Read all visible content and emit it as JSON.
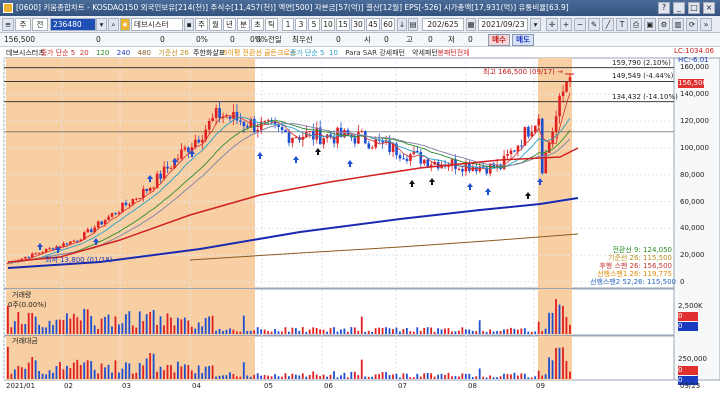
{
  "window": {
    "title": "[0600] 키움종합차트 - KOSDAQ150 외국인보유[214(천)] 주식수[11,457(천)] 액면[500] 자본금[57(억)] 결산[12월] EPS[-526] 시가총액[17,931(억)] 유통비율[63.9]",
    "buttons": [
      "?",
      "_",
      "□",
      "×"
    ]
  },
  "toolbar": {
    "tabs": [
      "주",
      "전"
    ],
    "code": "236480",
    "name": "데브시스터",
    "period_buttons": [
      "주",
      "월",
      "년",
      "분",
      "초",
      "틱"
    ],
    "intervals": [
      "1",
      "3",
      "5",
      "10",
      "15",
      "30",
      "45",
      "60"
    ],
    "count": "202/625",
    "date": "2021/09/23"
  },
  "infobar": {
    "price": "156,500",
    "v1": "0",
    "v2": "0",
    "v3": "0%",
    "v4": "0",
    "v5": "0%",
    "prev_label": "0%전일",
    "prev_val": "0",
    "ratio_label": "최우선",
    "k1": "0",
    "k2": "시",
    "k3": "0",
    "k4": "고",
    "k5": "0",
    "k6": "저",
    "k7": "0",
    "buy": "매수",
    "sell": "매도"
  },
  "indicators": [
    {
      "text": "데브시스터즈",
      "color": "#111111"
    },
    {
      "text": "종가 단순 5",
      "color": "#d03030"
    },
    {
      "text": "20",
      "color": "#d03030"
    },
    {
      "text": "120",
      "color": "#2a8a2a"
    },
    {
      "text": "240",
      "color": "#1a3ac0"
    },
    {
      "text": "480",
      "color": "#8a5a20"
    },
    {
      "text": "기준선 26",
      "color": "#b89020"
    },
    {
      "text": "주한화살표",
      "color": "#111111"
    },
    {
      "text": "5이평 전환선 골든크로스",
      "color": "#e08a00"
    },
    {
      "text": "종가 단순 5",
      "color": "#2aa0c8"
    },
    {
      "text": "10",
      "color": "#2aa0c8"
    },
    {
      "text": "Para SAR 강세패턴",
      "color": "#333333"
    },
    {
      "text": "약세패턴",
      "color": "#333333"
    },
    {
      "text": "봉패턴전체",
      "color": "#d03030"
    }
  ],
  "price_axis": {
    "labels": [
      "160,000",
      "140,000",
      "120,000",
      "100,000",
      "80,000",
      "60,000",
      "40,000",
      "20,000",
      "0"
    ],
    "hi_label": "LC:1034.06",
    "lo_label": "HC:-6.01",
    "current": "156,500"
  },
  "price_lines": [
    {
      "label": "159,790 (2.10%)",
      "value": 159790
    },
    {
      "label": "149,549 (-4.44%)",
      "value": 149549
    },
    {
      "label": "134,432 (-14.10%)",
      "value": 134432
    }
  ],
  "annotations": {
    "high": "최고 166,500 (09/17) →",
    "low": "최저 13,800 (01/18)"
  },
  "legend": [
    {
      "text": "전환선 9: 124,050",
      "color": "#2a8a2a"
    },
    {
      "text": "기준선 26: 115,500",
      "color": "#b89020"
    },
    {
      "text": "후행 스팬 26: 156,500",
      "color": "#c03030"
    },
    {
      "text": "선행스팬1 26: 119,775",
      "color": "#e08a00"
    },
    {
      "text": "선행스팬2 52,26: 115,500",
      "color": "#2a6ac0"
    }
  ],
  "volume": {
    "title": "거래량",
    "sub": "0주(0.00%)",
    "axis": [
      "2,500K",
      "0"
    ],
    "current": "0"
  },
  "amount": {
    "title": "거래대금",
    "axis": [
      "250,000",
      "0"
    ],
    "current": "0"
  },
  "x_axis": {
    "labels": [
      "2021/01",
      "02",
      "03",
      "04",
      "05",
      "06",
      "07",
      "08",
      "09"
    ],
    "end": "09/23"
  },
  "chart_data": {
    "type": "candlestick",
    "x": [
      "2021/01",
      "02",
      "03",
      "04",
      "05",
      "06",
      "07",
      "08",
      "09"
    ],
    "close_by_month": [
      14000,
      32000,
      70000,
      125000,
      110000,
      108000,
      90000,
      85000,
      156500
    ],
    "high": 166500,
    "high_date": "09/17",
    "low": 13800,
    "low_date": "01/18",
    "ylim": [
      0,
      170000
    ],
    "shaded_periods": [
      [
        "2021/01",
        "05"
      ],
      [
        "09",
        "09/23"
      ]
    ]
  }
}
